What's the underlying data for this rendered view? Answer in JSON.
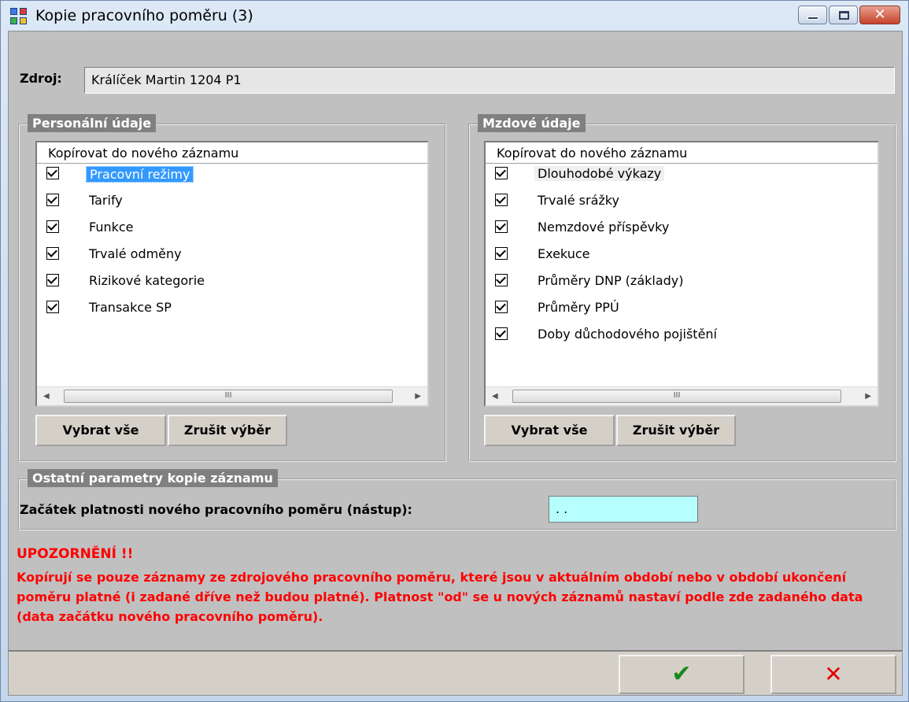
{
  "window": {
    "title": "Kopie pracovního poměru (3)",
    "close_glyph": "✕"
  },
  "source": {
    "label": "Zdroj:",
    "value": "Králíček Martin 1204 P1"
  },
  "personal": {
    "group_title": "Personální údaje",
    "list_header": "Kopírovat do nového záznamu",
    "items": [
      {
        "label": "Pracovní režimy",
        "checked": true
      },
      {
        "label": "Tarify",
        "checked": true
      },
      {
        "label": "Funkce",
        "checked": true
      },
      {
        "label": "Trvalé odměny",
        "checked": true
      },
      {
        "label": "Rizikové kategorie",
        "checked": true
      },
      {
        "label": "Transakce SP",
        "checked": true
      }
    ],
    "select_all": "Vybrat vše",
    "clear_selection": "Zrušit výběr"
  },
  "wage": {
    "group_title": "Mzdové údaje",
    "list_header": "Kopírovat do nového záznamu",
    "items": [
      {
        "label": "Dlouhodobé výkazy",
        "checked": true
      },
      {
        "label": "Trvalé srážky",
        "checked": true
      },
      {
        "label": "Nemzdové příspěvky",
        "checked": true
      },
      {
        "label": "Exekuce",
        "checked": true
      },
      {
        "label": "Průměry DNP (základy)",
        "checked": true
      },
      {
        "label": "Průměry PPÚ",
        "checked": true
      },
      {
        "label": "Doby důchodového pojištění",
        "checked": true
      }
    ],
    "select_all": "Vybrat vše",
    "clear_selection": "Zrušit výběr"
  },
  "scrollbar": {
    "left_arrow": "◀",
    "right_arrow": "▶",
    "thumb_grip": "III"
  },
  "other": {
    "group_title": "Ostatní parametry kopie záznamu",
    "date_label": "Začátek platnosti nového pracovního poměru (nástup):",
    "date_value": " . ."
  },
  "warning": {
    "title": "UPOZORNĚNÍ !!",
    "text": "Kopírují se pouze záznamy ze zdrojového pracovního poměru, které jsou v aktuálním období nebo v období ukončení poměru platné (i zadané dříve než budou platné). Platnost \"od\" se u nových záznamů nastaví podle zde zadaného data (data začátku nového pracovního poměru)."
  },
  "footer": {
    "ok_glyph": "✔",
    "cancel_glyph": "✕"
  },
  "colors": {
    "warning": "#ff0000",
    "date_field": "#b7ffff",
    "selection": "#3399ff"
  }
}
